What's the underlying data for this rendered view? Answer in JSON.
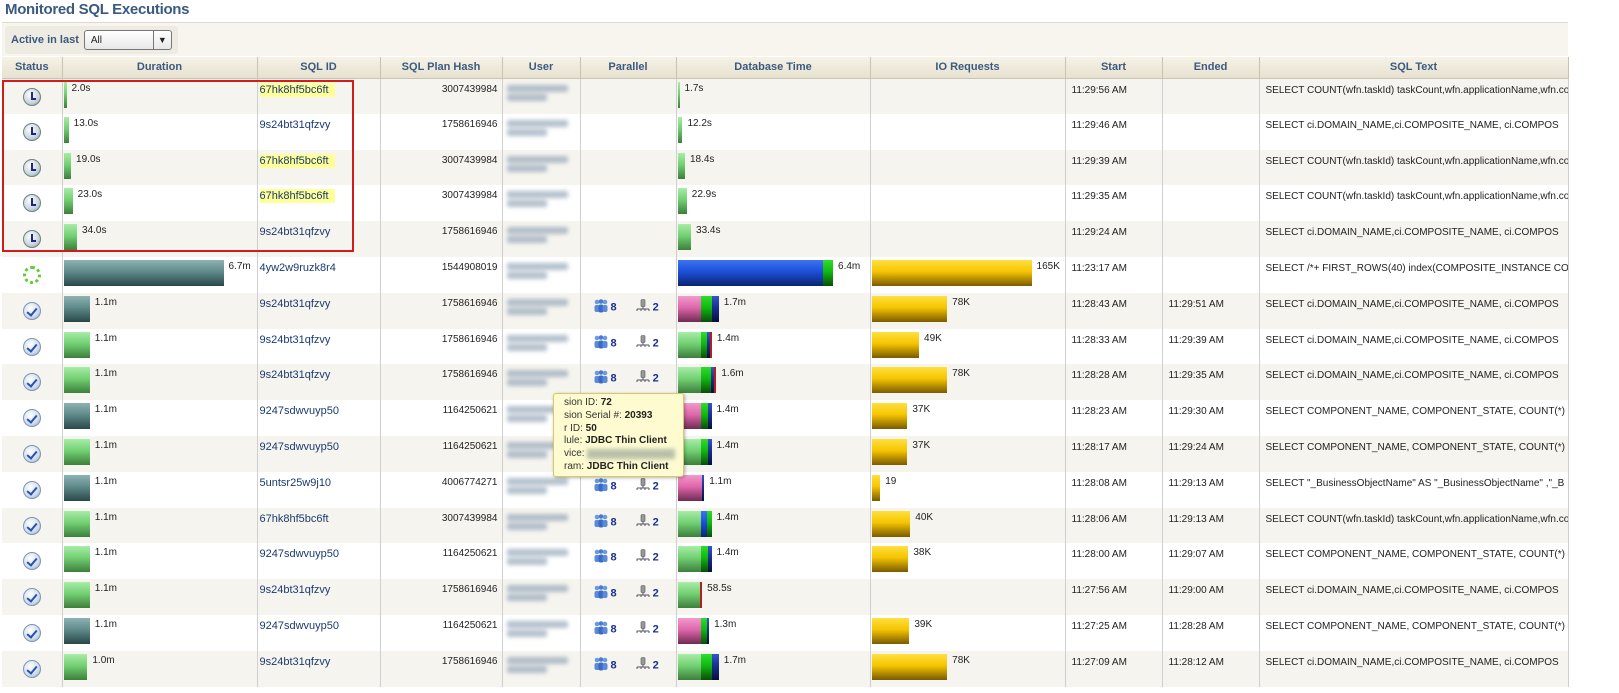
{
  "page_title": "Monitored SQL Executions",
  "filter": {
    "label": "Active in last",
    "value": "All"
  },
  "columns": [
    "Status",
    "Duration",
    "SQL ID",
    "SQL Plan Hash",
    "User",
    "Parallel",
    "Database Time",
    "IO Requests",
    "Start",
    "Ended",
    "SQL Text"
  ],
  "colors": {
    "highlight_box": "#d01c1c",
    "sql_id_highlight": "#ffff99",
    "header_text": "#3a5a80"
  },
  "rows": [
    {
      "status": "waiting",
      "duration": "2.0s",
      "dur_s": 2,
      "dur_color": "green",
      "sql_id": "67hk8hf5bc6ft",
      "hl": true,
      "plan_hash": "3007439984",
      "par": null,
      "db_time": "1.7s",
      "db": [
        [
          "green",
          1.7
        ]
      ],
      "io": "",
      "io_k": 0,
      "start": "11:29:56 AM",
      "ended": "",
      "sql_text": "SELECT COUNT(wfn.taskId) taskCount,wfn.applicationName,wfn.co"
    },
    {
      "status": "waiting",
      "duration": "13.0s",
      "dur_s": 13,
      "dur_color": "green",
      "sql_id": "9s24bt31qfzvy",
      "hl": false,
      "plan_hash": "1758616946",
      "par": null,
      "db_time": "12.2s",
      "db": [
        [
          "green",
          12.2
        ]
      ],
      "io": "",
      "io_k": 0,
      "start": "11:29:46 AM",
      "ended": "",
      "sql_text": "SELECT ci.DOMAIN_NAME,ci.COMPOSITE_NAME,  ci.COMPOS"
    },
    {
      "status": "waiting",
      "duration": "19.0s",
      "dur_s": 19,
      "dur_color": "green",
      "sql_id": "67hk8hf5bc6ft",
      "hl": true,
      "plan_hash": "3007439984",
      "par": null,
      "db_time": "18.4s",
      "db": [
        [
          "green",
          18.4
        ]
      ],
      "io": "",
      "io_k": 0,
      "start": "11:29:39 AM",
      "ended": "",
      "sql_text": "SELECT COUNT(wfn.taskId) taskCount,wfn.applicationName,wfn.co"
    },
    {
      "status": "waiting",
      "duration": "23.0s",
      "dur_s": 23,
      "dur_color": "green",
      "sql_id": "67hk8hf5bc6ft",
      "hl": true,
      "plan_hash": "3007439984",
      "par": null,
      "db_time": "22.9s",
      "db": [
        [
          "green",
          22.9
        ]
      ],
      "io": "",
      "io_k": 0,
      "start": "11:29:35 AM",
      "ended": "",
      "sql_text": "SELECT COUNT(wfn.taskId) taskCount,wfn.applicationName,wfn.co"
    },
    {
      "status": "waiting",
      "duration": "34.0s",
      "dur_s": 34,
      "dur_color": "green",
      "sql_id": "9s24bt31qfzvy",
      "hl": false,
      "plan_hash": "1758616946",
      "par": null,
      "db_time": "33.4s",
      "db": [
        [
          "green",
          33.4
        ]
      ],
      "io": "",
      "io_k": 0,
      "start": "11:29:24 AM",
      "ended": "",
      "sql_text": "SELECT ci.DOMAIN_NAME,ci.COMPOSITE_NAME,  ci.COMPOS"
    },
    {
      "status": "running",
      "duration": "6.7m",
      "dur_s": 402,
      "dur_color": "teal",
      "sql_id": "4yw2w9ruzk8r4",
      "hl": false,
      "plan_hash": "1544908019",
      "par": null,
      "db_time": "6.4m",
      "db": [
        [
          "blue",
          360
        ],
        [
          "dgreen",
          24
        ]
      ],
      "io": "165K",
      "io_k": 165,
      "start": "11:23:17 AM",
      "ended": "",
      "sql_text": "SELECT /*+ FIRST_ROWS(40) index(COMPOSITE_INSTANCE CO"
    },
    {
      "status": "done",
      "duration": "1.1m",
      "dur_s": 66,
      "dur_color": "teal",
      "sql_id": "9s24bt31qfzvy",
      "hl": false,
      "plan_hash": "1758616946",
      "par": {
        "servers": "8",
        "instances": "2"
      },
      "db_time": "1.7m",
      "db": [
        [
          "pink",
          58
        ],
        [
          "dgreen",
          26
        ],
        [
          "navy",
          18
        ]
      ],
      "io": "78K",
      "io_k": 78,
      "start": "11:28:43 AM",
      "ended": "11:29:51 AM",
      "sql_text": "SELECT ci.DOMAIN_NAME,ci.COMPOSITE_NAME,  ci.COMPOS"
    },
    {
      "status": "done",
      "duration": "1.1m",
      "dur_s": 66,
      "dur_color": "green",
      "sql_id": "9s24bt31qfzvy",
      "hl": false,
      "plan_hash": "1758616946",
      "par": {
        "servers": "8",
        "instances": "2"
      },
      "db_time": "1.4m",
      "db": [
        [
          "green",
          58
        ],
        [
          "dgreen",
          16
        ],
        [
          "navy",
          6
        ],
        [
          "red",
          4
        ]
      ],
      "io": "49K",
      "io_k": 49,
      "start": "11:28:33 AM",
      "ended": "11:29:39 AM",
      "sql_text": "SELECT ci.DOMAIN_NAME,ci.COMPOSITE_NAME,  ci.COMPOS"
    },
    {
      "status": "done",
      "duration": "1.1m",
      "dur_s": 66,
      "dur_color": "green",
      "sql_id": "9s24bt31qfzvy",
      "hl": false,
      "plan_hash": "1758616946",
      "par": {
        "servers": "8",
        "instances": "2"
      },
      "db_time": "1.6m",
      "db": [
        [
          "green",
          58
        ],
        [
          "dgreen",
          24
        ],
        [
          "navy",
          8
        ],
        [
          "red",
          6
        ]
      ],
      "io": "78K",
      "io_k": 78,
      "start": "11:28:28 AM",
      "ended": "11:29:35 AM",
      "sql_text": "SELECT ci.DOMAIN_NAME,ci.COMPOSITE_NAME,  ci.COMPOS"
    },
    {
      "status": "done",
      "duration": "1.1m",
      "dur_s": 66,
      "dur_color": "teal",
      "sql_id": "9247sdwvuyp50",
      "hl": false,
      "plan_hash": "1164250621",
      "par": {
        "servers": "8",
        "instances": "2"
      },
      "db_time": "1.4m",
      "db": [
        [
          "pink",
          58
        ],
        [
          "dgreen",
          18
        ],
        [
          "navy",
          8
        ]
      ],
      "io": "37K",
      "io_k": 37,
      "start": "11:28:23 AM",
      "ended": "11:29:30 AM",
      "sql_text": "SELECT COMPONENT_NAME, COMPONENT_STATE, COUNT(*)"
    },
    {
      "status": "done",
      "duration": "1.1m",
      "dur_s": 66,
      "dur_color": "green",
      "sql_id": "9247sdwvuyp50",
      "hl": false,
      "plan_hash": "1164250621",
      "par": {
        "servers": "8",
        "instances": "2"
      },
      "db_time": "1.4m",
      "db": [
        [
          "green",
          58
        ],
        [
          "dgreen",
          18
        ],
        [
          "navy",
          8
        ]
      ],
      "io": "37K",
      "io_k": 37,
      "start": "11:28:17 AM",
      "ended": "11:29:24 AM",
      "sql_text": "SELECT COMPONENT_NAME, COMPONENT_STATE, COUNT(*)"
    },
    {
      "status": "done",
      "duration": "1.1m",
      "dur_s": 66,
      "dur_color": "teal",
      "sql_id": "5untsr25w9j10",
      "hl": false,
      "plan_hash": "4006774271",
      "par": {
        "servers": "8",
        "instances": "2"
      },
      "db_time": "1.1m",
      "db": [
        [
          "pink",
          60
        ],
        [
          "navy",
          6
        ]
      ],
      "io": "19",
      "io_k": 9,
      "start": "11:28:08 AM",
      "ended": "11:29:13 AM",
      "sql_text": "SELECT \"_BusinessObjectName\" AS \"_BusinessObjectName\" ,\"_B"
    },
    {
      "status": "done",
      "duration": "1.1m",
      "dur_s": 66,
      "dur_color": "green",
      "sql_id": "67hk8hf5bc6ft",
      "hl": false,
      "plan_hash": "3007439984",
      "par": {
        "servers": "8",
        "instances": "2"
      },
      "db_time": "1.4m",
      "db": [
        [
          "green",
          58
        ],
        [
          "blue",
          16
        ],
        [
          "dgreen",
          10
        ]
      ],
      "io": "40K",
      "io_k": 40,
      "start": "11:28:06 AM",
      "ended": "11:29:13 AM",
      "sql_text": "SELECT COUNT(wfn.taskId) taskCount,wfn.applicationName,wfn.co"
    },
    {
      "status": "done",
      "duration": "1.1m",
      "dur_s": 66,
      "dur_color": "green",
      "sql_id": "9247sdwvuyp50",
      "hl": false,
      "plan_hash": "1164250621",
      "par": {
        "servers": "8",
        "instances": "2"
      },
      "db_time": "1.4m",
      "db": [
        [
          "green",
          58
        ],
        [
          "dgreen",
          18
        ],
        [
          "navy",
          8
        ]
      ],
      "io": "38K",
      "io_k": 38,
      "start": "11:28:00 AM",
      "ended": "11:29:07 AM",
      "sql_text": "SELECT COMPONENT_NAME, COMPONENT_STATE, COUNT(*)"
    },
    {
      "status": "done",
      "duration": "1.1m",
      "dur_s": 66,
      "dur_color": "green",
      "sql_id": "9s24bt31qfzvy",
      "hl": false,
      "plan_hash": "1758616946",
      "par": {
        "servers": "8",
        "instances": "2"
      },
      "db_time": "58.5s",
      "db": [
        [
          "green",
          56
        ],
        [
          "red",
          2.5
        ]
      ],
      "io": "",
      "io_k": 0,
      "start": "11:27:56 AM",
      "ended": "11:29:00 AM",
      "sql_text": "SELECT ci.DOMAIN_NAME,ci.COMPOSITE_NAME,  ci.COMPOS"
    },
    {
      "status": "done",
      "duration": "1.1m",
      "dur_s": 66,
      "dur_color": "teal",
      "sql_id": "9247sdwvuyp50",
      "hl": false,
      "plan_hash": "1164250621",
      "par": {
        "servers": "8",
        "instances": "2"
      },
      "db_time": "1.3m",
      "db": [
        [
          "pink",
          58
        ],
        [
          "dgreen",
          14
        ],
        [
          "navy",
          6
        ]
      ],
      "io": "39K",
      "io_k": 39,
      "start": "11:27:25 AM",
      "ended": "11:28:28 AM",
      "sql_text": "SELECT COMPONENT_NAME, COMPONENT_STATE, COUNT(*)"
    },
    {
      "status": "done",
      "duration": "1.0m",
      "dur_s": 60,
      "dur_color": "green",
      "sql_id": "9s24bt31qfzvy",
      "hl": false,
      "plan_hash": "1758616946",
      "par": {
        "servers": "8",
        "instances": "2"
      },
      "db_time": "1.7m",
      "db": [
        [
          "green",
          58
        ],
        [
          "dgreen",
          26
        ],
        [
          "navy",
          18
        ]
      ],
      "io": "78K",
      "io_k": 78,
      "start": "11:27:09 AM",
      "ended": "11:28:12 AM",
      "sql_text": "SELECT ci.DOMAIN_NAME,ci.COMPOSITE_NAME,  ci.COMPOS"
    }
  ],
  "tooltip": {
    "lines": [
      {
        "label": "sion ID: ",
        "value": "72"
      },
      {
        "label": "sion Serial #: ",
        "value": "20393"
      },
      {
        "label": "r ID: ",
        "value": "50"
      },
      {
        "label": "lule: ",
        "value": "JDBC Thin Client"
      },
      {
        "label": "vice: ",
        "value": ""
      },
      {
        "label": "ram: ",
        "value": "JDBC Thin Client"
      }
    ]
  }
}
